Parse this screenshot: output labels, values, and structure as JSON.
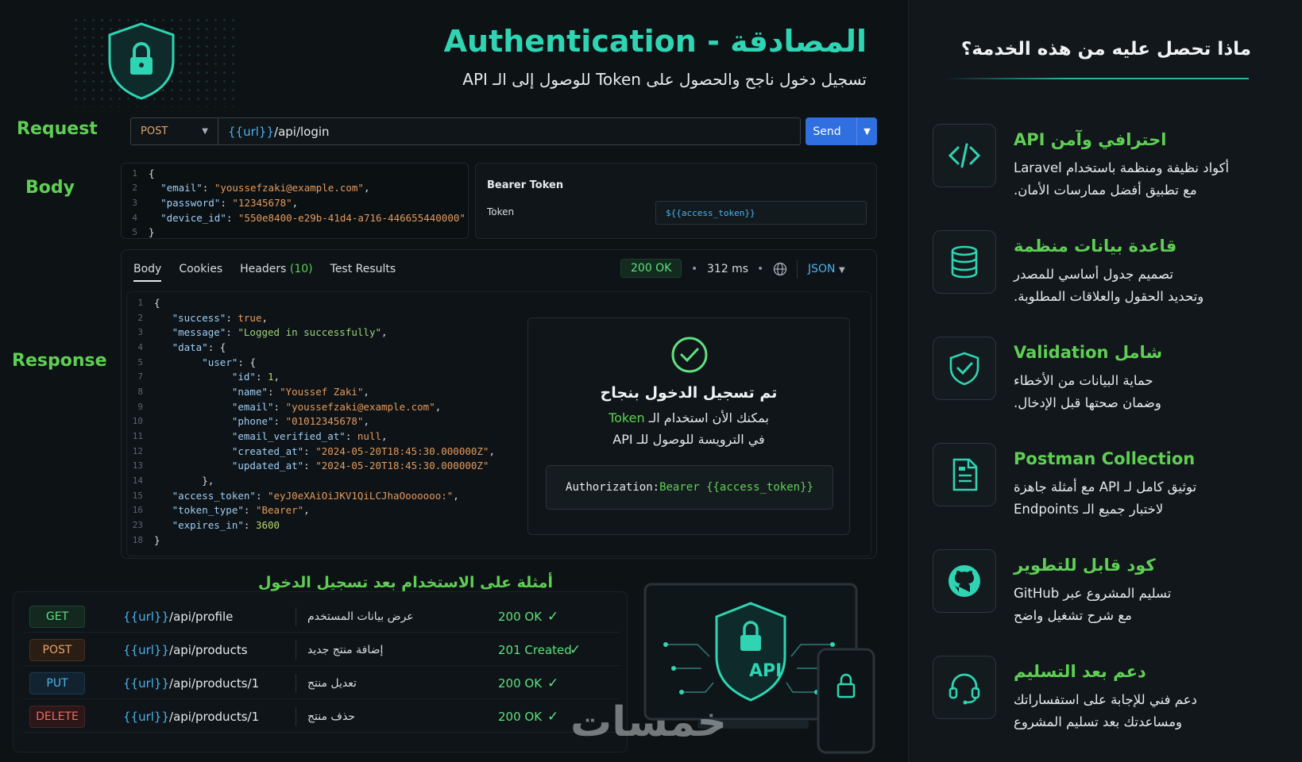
{
  "header": {
    "title": "Authentication - المصادقة",
    "subtitle": "تسجيل دخول ناجح والحصول على Token للوصول إلى الـ API"
  },
  "labels": {
    "request": "Request",
    "body": "Body",
    "response": "Response"
  },
  "request": {
    "method": "POST",
    "url_var": "{{url}}",
    "url_path": "/api/login",
    "send": "Send"
  },
  "body_code": [
    {
      "n": "1",
      "t": "{"
    },
    {
      "n": "2",
      "k": "\"email\"",
      "v": "\"youssefzaki@example.com\"",
      "c": ","
    },
    {
      "n": "3",
      "k": "\"password\"",
      "v": "\"12345678\"",
      "c": ","
    },
    {
      "n": "4",
      "k": "\"device_id\"",
      "v": "\"550e8400-e29b-41d4-a716-446655440000\"",
      "c": ""
    },
    {
      "n": "5",
      "t": "}"
    }
  ],
  "bearer": {
    "title": "Bearer Token",
    "token_label": "Token",
    "token_value": "${{access_token}}"
  },
  "response": {
    "tabs": [
      "Body",
      "Cookies",
      "Headers",
      "Test Results"
    ],
    "headers_count": "(10)",
    "status": "200 OK",
    "time": "312 ms",
    "format": "JSON",
    "lines": [
      {
        "n": "1",
        "i": 0,
        "t": "{"
      },
      {
        "n": "2",
        "i": 1,
        "k": "\"success\"",
        "v": "true",
        "vt": "b",
        "c": ","
      },
      {
        "n": "3",
        "i": 1,
        "k": "\"message\"",
        "v": "\"Logged in successfully\"",
        "vt": "sg",
        "c": ","
      },
      {
        "n": "4",
        "i": 1,
        "k": "\"data\"",
        "v": "{",
        "vt": "p",
        "c": ""
      },
      {
        "n": "5",
        "i": 2,
        "k": "\"user\"",
        "v": "{",
        "vt": "p",
        "c": ""
      },
      {
        "n": "7",
        "i": 3,
        "k": "\"id\"",
        "v": "1",
        "vt": "n",
        "c": ","
      },
      {
        "n": "8",
        "i": 3,
        "k": "\"name\"",
        "v": "\"Youssef Zaki\"",
        "vt": "s",
        "c": ","
      },
      {
        "n": "9",
        "i": 3,
        "k": "\"email\"",
        "v": "\"youssefzaki@example.com\"",
        "vt": "s",
        "c": ","
      },
      {
        "n": "10",
        "i": 3,
        "k": "\"phone\"",
        "v": "\"01012345678\"",
        "vt": "s",
        "c": ","
      },
      {
        "n": "11",
        "i": 3,
        "k": "\"email_verified_at\"",
        "v": "null",
        "vt": "b",
        "c": ","
      },
      {
        "n": "12",
        "i": 3,
        "k": "\"created_at\"",
        "v": "\"2024-05-20T18:45:30.000000Z\"",
        "vt": "s",
        "c": ","
      },
      {
        "n": "13",
        "i": 3,
        "k": "\"updated_at\"",
        "v": "\"2024-05-20T18:45:30.000000Z\"",
        "vt": "s",
        "c": ""
      },
      {
        "n": "14",
        "i": 2,
        "t": "},"
      },
      {
        "n": "15",
        "i": 1,
        "k": "\"access_token\"",
        "v": "\"eyJ0eXAiOiJKV1QiLCJhaOoooooo:\"",
        "vt": "s",
        "c": ","
      },
      {
        "n": "16",
        "i": 1,
        "k": "\"token_type\"",
        "v": "\"Bearer\"",
        "vt": "s",
        "c": ","
      },
      {
        "n": "23",
        "i": 1,
        "k": "\"expires_in\"",
        "v": "3600",
        "vt": "n",
        "c": ""
      },
      {
        "n": "18",
        "i": 0,
        "t": "}"
      }
    ]
  },
  "success_card": {
    "title": "تم تسجيل الدخول بنجاح",
    "line1_pre": "بمكنك الأن استخدام الـ",
    "line1_token": "Token",
    "line2": "في الترويسة للوصول للـ API",
    "auth_key": "Authorization:",
    "auth_val": "Bearer {{access_token}}"
  },
  "examples": {
    "heading": "أمثلة على الاستخدام بعد تسجيل الدخول",
    "rows": [
      {
        "method": "GET",
        "var": "{{url}}",
        "path": "/api/profile",
        "desc": "عرض بيانات المستخدم",
        "status": "200 OK",
        "mcolor": "#5fe07e",
        "mbg": "#13291f",
        "mborder": "#1f4431"
      },
      {
        "method": "POST",
        "var": "{{url}}",
        "path": "/api/products",
        "desc": "إضافة منتج جديد",
        "status": "201 Created",
        "mcolor": "#e6a36b",
        "mbg": "#2a1d14",
        "mborder": "#4a3120"
      },
      {
        "method": "PUT",
        "var": "{{url}}",
        "path": "/api/products/1",
        "desc": "تعديل منتج",
        "status": "200 OK",
        "mcolor": "#4db2ef",
        "mbg": "#12222e",
        "mborder": "#1d3a4f"
      },
      {
        "method": "DELETE",
        "var": "{{url}}",
        "path": "/api/products/1",
        "desc": "حذف منتج",
        "status": "200 OK",
        "mcolor": "#ef6b60",
        "mbg": "#2c1617",
        "mborder": "#4f2425"
      }
    ]
  },
  "api_label": "API",
  "watermark": "خمسات",
  "sidebar": {
    "heading": "ماذا تحصل عليه من هذه الخدمة؟",
    "features": [
      {
        "icon": "code-icon",
        "title": "API احترافي وآمن",
        "line1": "أكواد نظيفة ومنظمة باستخدام Laravel",
        "line2": "مع تطبيق أفضل ممارسات الأمان."
      },
      {
        "icon": "database-icon",
        "title": "قاعدة بيانات منظمة",
        "line1": "تصميم جدول أساسي للمصدر",
        "line2": "وتحديد الحقول والعلاقات المطلوبة."
      },
      {
        "icon": "shield-check-icon",
        "title": "Validation شامل",
        "line1": "حماية البيانات من الأخطاء",
        "line2": "وضمان صحتها قبل الإدخال."
      },
      {
        "icon": "document-icon",
        "title": "Postman Collection",
        "line1": "توثيق كامل لـ API مع أمثلة جاهزة",
        "line2": "لاختبار جميع الـ Endpoints"
      },
      {
        "icon": "github-icon",
        "title": "كود قابل للتطوير",
        "line1": "تسليم المشروع عبر GitHub",
        "line2": "مع شرح تشغيل واضح"
      },
      {
        "icon": "headset-icon",
        "title": "دعم بعد التسليم",
        "line1": "دعم فني للإجابة على استفساراتك",
        "line2": "ومساعدتك بعد تسليم المشروع"
      }
    ]
  }
}
